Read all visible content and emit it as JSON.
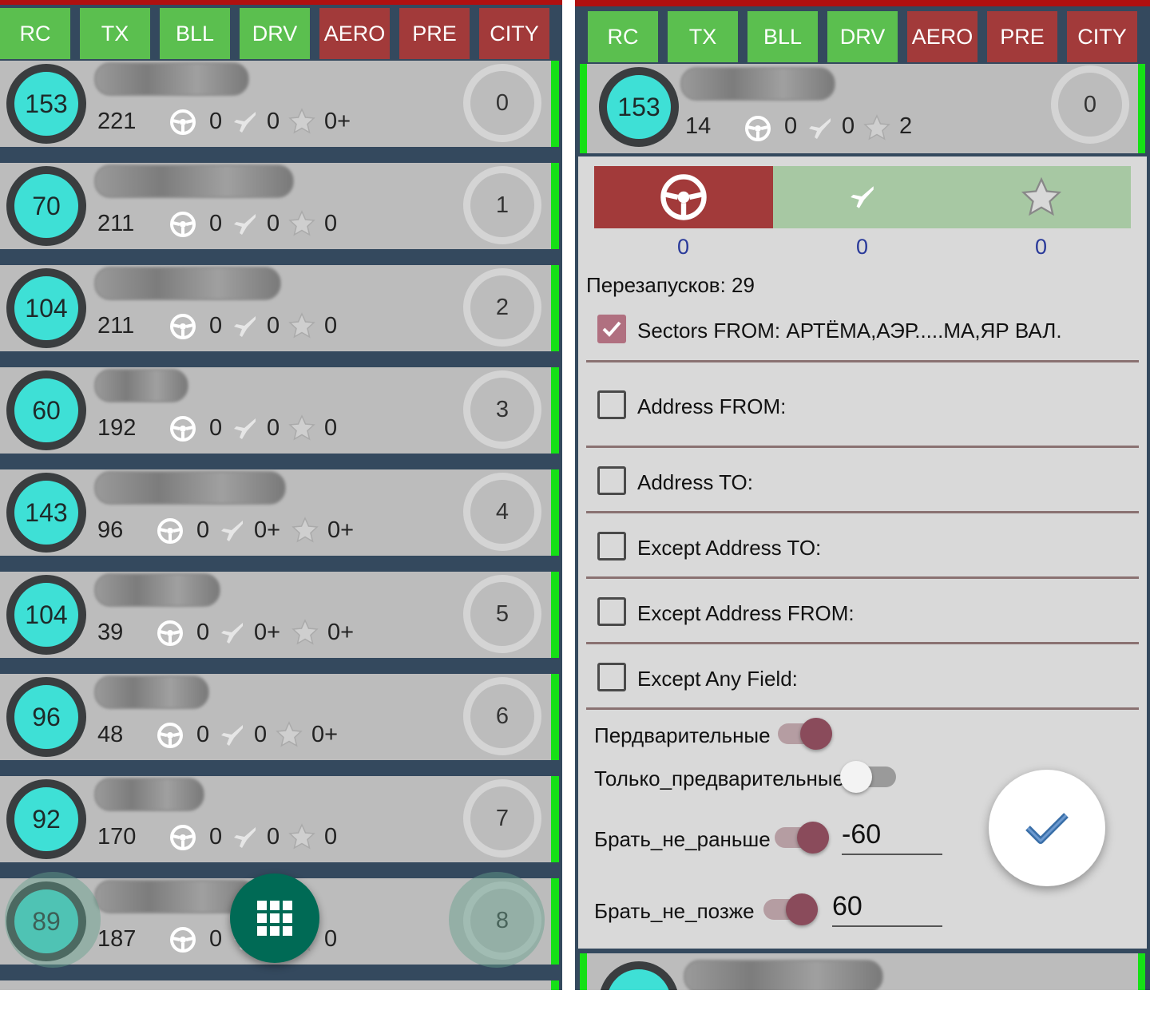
{
  "tabs": [
    {
      "label": "RC",
      "state": "green"
    },
    {
      "label": "TX",
      "state": "green"
    },
    {
      "label": "BLL",
      "state": "green"
    },
    {
      "label": "DRV",
      "state": "green"
    },
    {
      "label": "AERO",
      "state": "red"
    },
    {
      "label": "PRE",
      "state": "red"
    },
    {
      "label": "CITY",
      "state": "red"
    }
  ],
  "list": [
    {
      "badge": "153",
      "count": "221",
      "drive": "0",
      "plane": "0",
      "star": "0+",
      "queue": "0"
    },
    {
      "badge": "70",
      "count": "211",
      "drive": "0",
      "plane": "0",
      "star": "0",
      "queue": "1"
    },
    {
      "badge": "104",
      "count": "211",
      "drive": "0",
      "plane": "0",
      "star": "0",
      "queue": "2"
    },
    {
      "badge": "60",
      "count": "192",
      "drive": "0",
      "plane": "0",
      "star": "0",
      "queue": "3"
    },
    {
      "badge": "143",
      "count": "96",
      "drive": "0",
      "plane": "0+",
      "star": "0+",
      "queue": "4"
    },
    {
      "badge": "104",
      "count": "39",
      "drive": "0",
      "plane": "0+",
      "star": "0+",
      "queue": "5"
    },
    {
      "badge": "96",
      "count": "48",
      "drive": "0",
      "plane": "0",
      "star": "0+",
      "queue": "6"
    },
    {
      "badge": "92",
      "count": "170",
      "drive": "0",
      "plane": "0",
      "star": "0",
      "queue": "7"
    },
    {
      "badge": "89",
      "count": "187",
      "drive": "0",
      "plane": "",
      "star": "0",
      "queue": "8"
    }
  ],
  "detail": {
    "header": {
      "badge": "153",
      "count": "14",
      "drive": "0",
      "plane": "0",
      "star": "2",
      "queue": "0"
    },
    "segments": [
      {
        "icon": "steering-wheel-icon",
        "count": "0"
      },
      {
        "icon": "airplane-icon",
        "count": "0"
      },
      {
        "icon": "star-icon",
        "count": "0"
      }
    ],
    "restarts": "Перезапусков: 29",
    "filters": [
      {
        "label": "Sectors FROM: АРТЁМА,АЭР.....МА,ЯР ВАЛ.",
        "checked": true
      },
      {
        "label": "Address FROM:",
        "checked": false
      },
      {
        "label": "Address TO:",
        "checked": false
      },
      {
        "label": "Except Address TO:",
        "checked": false
      },
      {
        "label": "Except Address FROM:",
        "checked": false
      },
      {
        "label": "Except Any Field:",
        "checked": false
      }
    ],
    "toggles": [
      {
        "label": "Пердварительные",
        "on": true
      },
      {
        "label": "Только_предварительные",
        "on": false
      },
      {
        "label": "Брать_не_раньше",
        "on": true,
        "value": "-60"
      },
      {
        "label": "Брать_не_позже",
        "on": true,
        "value": "60"
      }
    ]
  },
  "colors": {
    "green": "#5bbf4f",
    "red": "#a23a3a",
    "teal": "#3ee0d6",
    "accent": "#006a55",
    "status_bar": "#16e016"
  }
}
